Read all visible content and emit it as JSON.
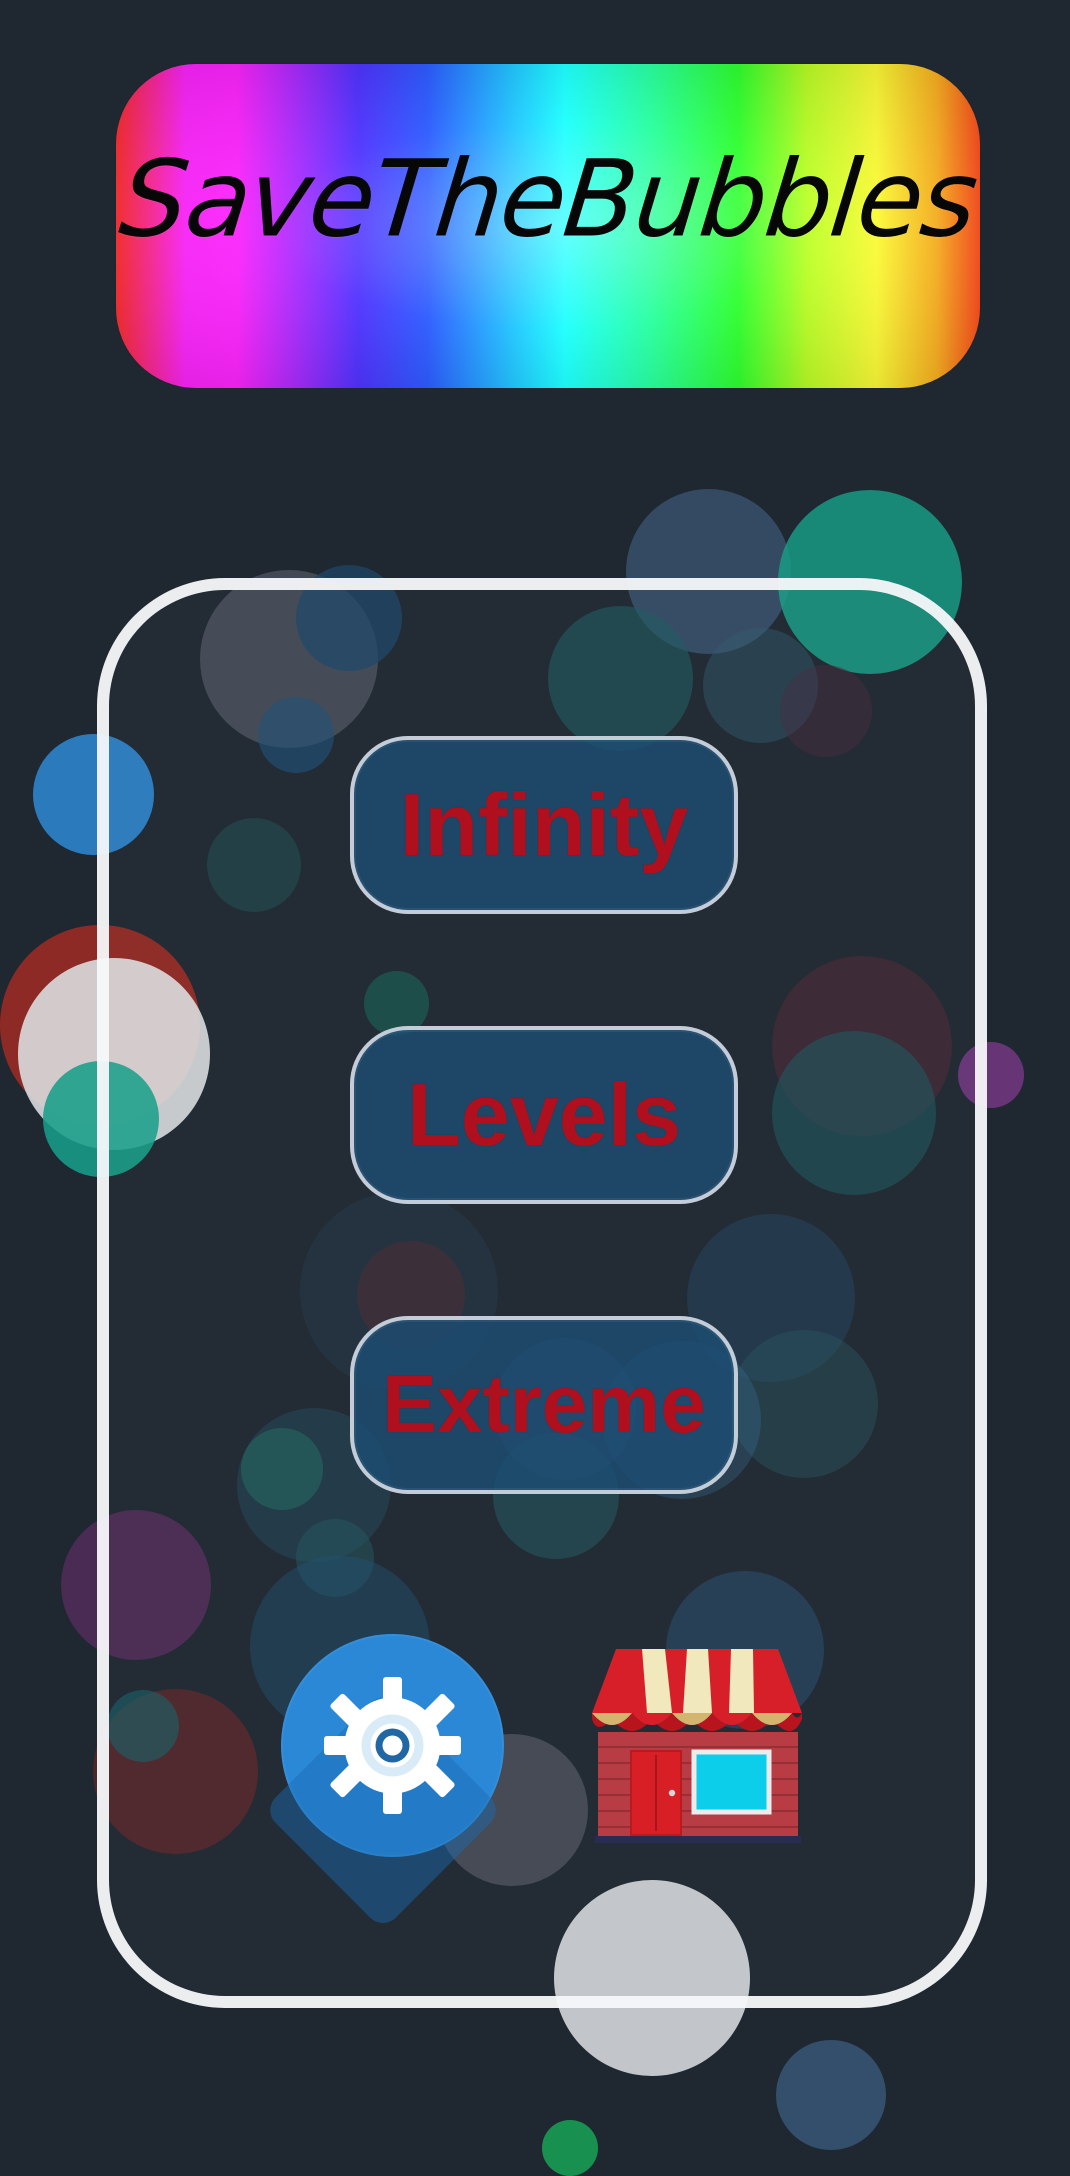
{
  "title_banner": {
    "text": "SaveTheBubbles"
  },
  "menu": {
    "buttons": [
      {
        "label": "Infinity"
      },
      {
        "label": "Levels"
      },
      {
        "label": "Extreme"
      }
    ]
  },
  "bottom_actions": {
    "settings_icon": "gear-icon",
    "shop_icon": "shop-icon"
  },
  "colors": {
    "background": "#1f2731",
    "panel_border": "#f5f6f8",
    "button_fill": "#1c4d73",
    "button_text": "#b0101e",
    "settings_blue": "#2b88d6",
    "shop_red": "#d11f24"
  }
}
